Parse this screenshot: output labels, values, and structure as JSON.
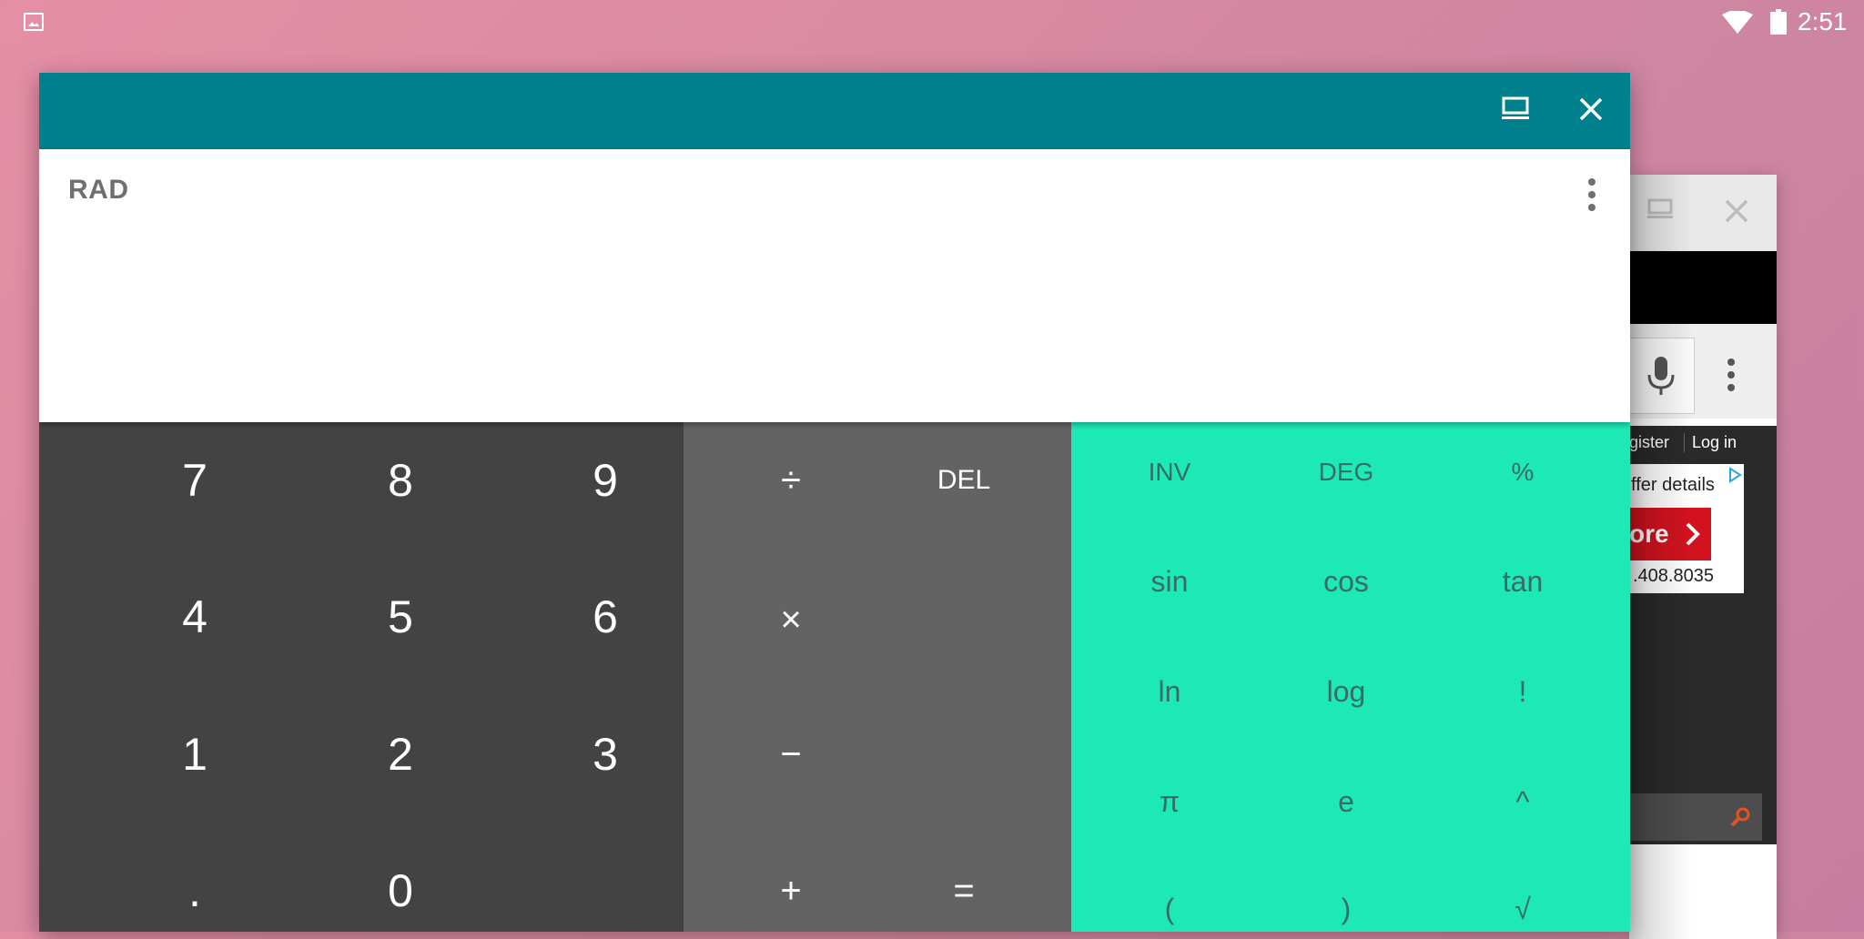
{
  "status_bar": {
    "time": "2:51",
    "icons": [
      "gallery-notification-icon",
      "wifi-icon",
      "battery-icon"
    ]
  },
  "background_window": {
    "links": {
      "register": "gister",
      "login": "Log in"
    },
    "ad": {
      "line1": "ffer details",
      "button": "ore",
      "phone": ".408.8035"
    }
  },
  "calculator": {
    "titlebar_color": "#00808d",
    "display": {
      "mode": "RAD",
      "expression": "",
      "result": ""
    },
    "numeric_keys": [
      "7",
      "8",
      "9",
      "4",
      "5",
      "6",
      "1",
      "2",
      "3",
      ".",
      "0"
    ],
    "operator_keys": {
      "divide": "÷",
      "delete": "DEL",
      "multiply": "×",
      "minus": "−",
      "plus": "+",
      "equals": "="
    },
    "advanced_keys": [
      "INV",
      "DEG",
      "%",
      "sin",
      "cos",
      "tan",
      "ln",
      "log",
      "!",
      "π",
      "e",
      "^",
      "(",
      ")",
      "√"
    ],
    "colors": {
      "numeric_pad": "#434343",
      "operator_pad": "#636363",
      "advanced_pad": "#1de9b6"
    }
  }
}
